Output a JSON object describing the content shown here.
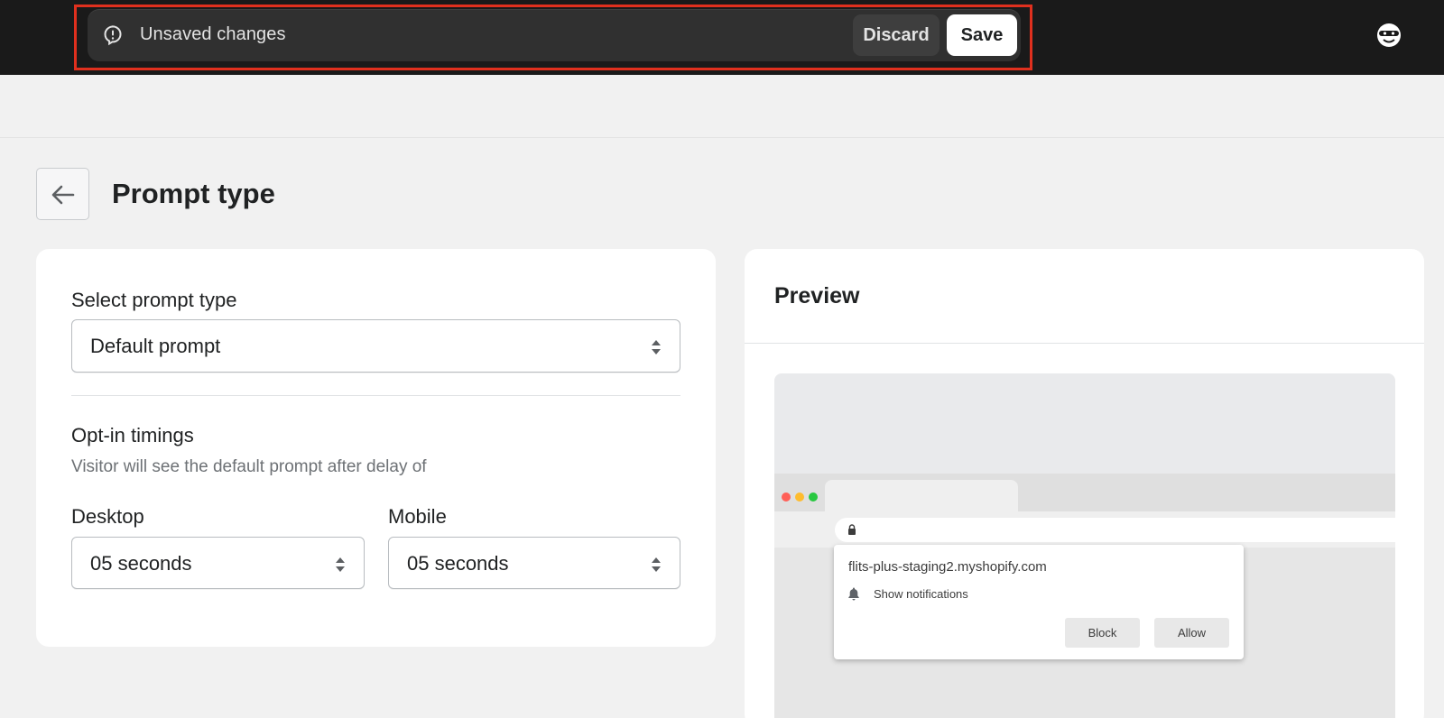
{
  "save_bar": {
    "message": "Unsaved changes",
    "discard_label": "Discard",
    "save_label": "Save"
  },
  "page": {
    "title": "Prompt type"
  },
  "settings": {
    "prompt_type_label": "Select prompt type",
    "prompt_type_value": "Default prompt",
    "opt_in_heading": "Opt-in timings",
    "opt_in_helper": "Visitor will see the default prompt after delay of",
    "desktop_label": "Desktop",
    "desktop_value": "05 seconds",
    "mobile_label": "Mobile",
    "mobile_value": "05 seconds"
  },
  "preview": {
    "title": "Preview",
    "domain": "flits-plus-staging2.myshopify.com",
    "notification_text": "Show notifications",
    "block_label": "Block",
    "allow_label": "Allow"
  },
  "colors": {
    "topbar_bg": "#1a1a1a",
    "highlight": "#e0301e",
    "traffic_red": "#ff5f57",
    "traffic_yellow": "#febc2e",
    "traffic_green": "#28c840"
  }
}
